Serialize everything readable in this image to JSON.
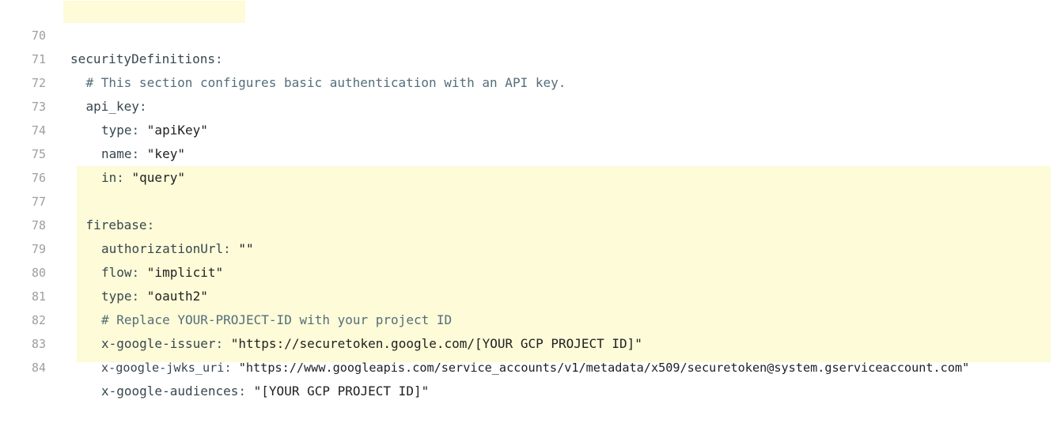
{
  "code": {
    "lines": [
      {
        "num": "70",
        "key": "securityDefinitions",
        "sep": ":",
        "value": ""
      },
      {
        "num": "71",
        "comment": "# This section configures basic authentication with an API key."
      },
      {
        "num": "72",
        "key": "api_key",
        "sep": ":",
        "value": ""
      },
      {
        "num": "73",
        "key": "type",
        "sep": ": ",
        "value": "\"apiKey\""
      },
      {
        "num": "74",
        "key": "name",
        "sep": ": ",
        "value": "\"key\""
      },
      {
        "num": "75",
        "key": "in",
        "sep": ": ",
        "value": "\"query\""
      },
      {
        "num": "76"
      },
      {
        "num": "77",
        "key": "firebase",
        "sep": ":",
        "value": ""
      },
      {
        "num": "78",
        "key": "authorizationUrl",
        "sep": ": ",
        "value": "\"\""
      },
      {
        "num": "79",
        "key": "flow",
        "sep": ": ",
        "value": "\"implicit\""
      },
      {
        "num": "80",
        "key": "type",
        "sep": ": ",
        "value": "\"oauth2\""
      },
      {
        "num": "81",
        "comment": "# Replace YOUR-PROJECT-ID with your project ID"
      },
      {
        "num": "82",
        "key": "x-google-issuer",
        "sep": ": ",
        "value": "\"https://securetoken.google.com/[YOUR GCP PROJECT ID]\""
      },
      {
        "num": "83",
        "key": "x-google-jwks_uri",
        "sep": ": ",
        "value": "\"https://www.googleapis.com/service_accounts/v1/metadata/x509/securetoken@system.gserviceaccount.com\""
      },
      {
        "num": "84",
        "key": "x-google-audiences",
        "sep": ": ",
        "value": "\"[YOUR GCP PROJECT ID]\""
      }
    ]
  },
  "colors": {
    "highlight": "#fdfbd8",
    "line_number": "#9e9e9e",
    "text": "#37474f"
  }
}
